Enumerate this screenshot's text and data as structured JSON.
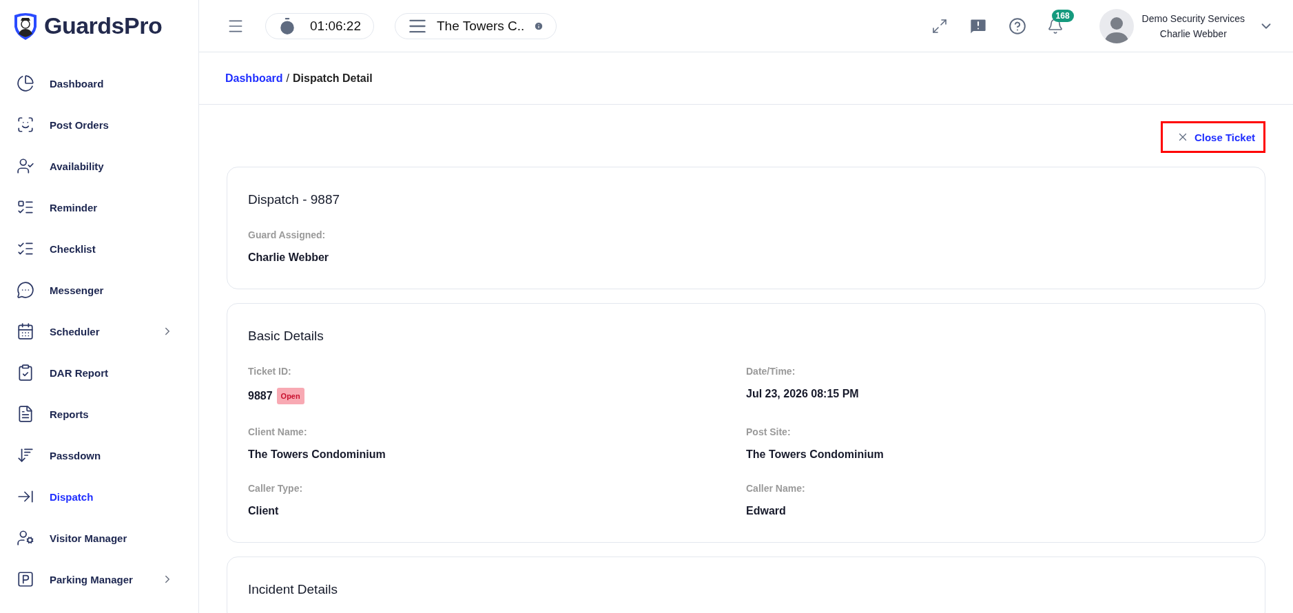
{
  "logo": {
    "text": "GuardsPro"
  },
  "sidebar": {
    "items": [
      {
        "label": "Dashboard",
        "selected": false,
        "expandable": false
      },
      {
        "label": "Post Orders",
        "selected": false,
        "expandable": false
      },
      {
        "label": "Availability",
        "selected": false,
        "expandable": false
      },
      {
        "label": "Reminder",
        "selected": false,
        "expandable": false
      },
      {
        "label": "Checklist",
        "selected": false,
        "expandable": false
      },
      {
        "label": "Messenger",
        "selected": false,
        "expandable": false
      },
      {
        "label": "Scheduler",
        "selected": false,
        "expandable": true
      },
      {
        "label": "DAR Report",
        "selected": false,
        "expandable": false
      },
      {
        "label": "Reports",
        "selected": false,
        "expandable": false
      },
      {
        "label": "Passdown",
        "selected": false,
        "expandable": false
      },
      {
        "label": "Dispatch",
        "selected": true,
        "expandable": false
      },
      {
        "label": "Visitor Manager",
        "selected": false,
        "expandable": false
      },
      {
        "label": "Parking Manager",
        "selected": false,
        "expandable": true
      }
    ]
  },
  "header": {
    "timer": "01:06:22",
    "site": "The Towers C..",
    "notification_count": "168",
    "user": {
      "company": "Demo Security Services",
      "name": "Charlie Webber"
    }
  },
  "breadcrumb": {
    "link": "Dashboard",
    "separator": "/",
    "current": "Dispatch Detail"
  },
  "close_button": {
    "label": "Close Ticket",
    "highlighted": true
  },
  "cards": [
    {
      "title": "Dispatch - 9887",
      "fields": [
        {
          "label": "Guard Assigned:",
          "value": "Charlie Webber"
        }
      ]
    },
    {
      "title": "Basic Details",
      "fields": [
        {
          "label": "Ticket ID:",
          "value": "9887",
          "badge": "Open"
        },
        {
          "label": "Date/Time:",
          "value": "Jul 23, 2026 08:15 PM"
        },
        {
          "label": "Client Name:",
          "value": "The Towers Condominium"
        },
        {
          "label": "Post Site:",
          "value": "The Towers Condominium"
        },
        {
          "label": "Caller Type:",
          "value": "Client"
        },
        {
          "label": "Caller Name:",
          "value": "Edward"
        }
      ]
    },
    {
      "title": "Incident Details"
    }
  ]
}
